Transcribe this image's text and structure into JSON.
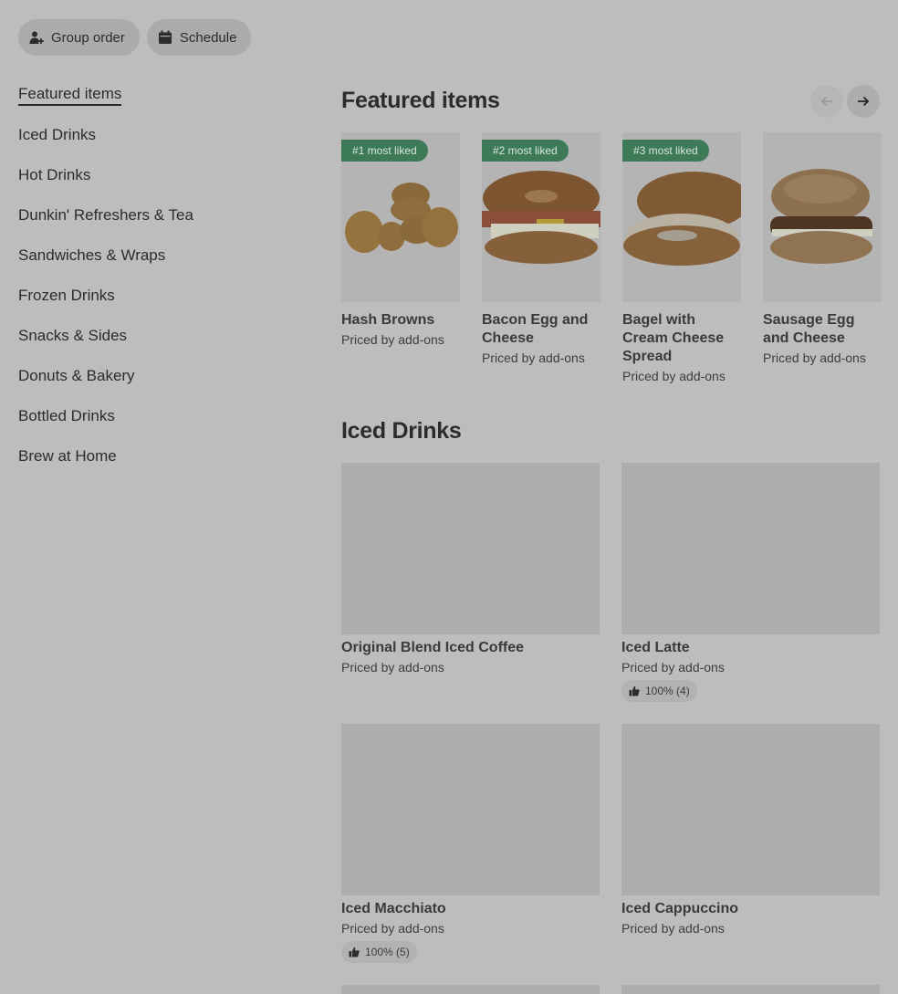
{
  "top_buttons": {
    "group_order": "Group order",
    "schedule": "Schedule"
  },
  "sidebar": {
    "items": [
      {
        "label": "Featured items"
      },
      {
        "label": "Iced Drinks"
      },
      {
        "label": "Hot Drinks"
      },
      {
        "label": "Dunkin' Refreshers & Tea"
      },
      {
        "label": "Sandwiches & Wraps"
      },
      {
        "label": "Frozen Drinks"
      },
      {
        "label": "Snacks & Sides"
      },
      {
        "label": "Donuts & Bakery"
      },
      {
        "label": "Bottled Drinks"
      },
      {
        "label": "Brew at Home"
      }
    ]
  },
  "featured": {
    "title": "Featured items",
    "items": [
      {
        "badge": "#1 most liked",
        "name": "Hash Browns",
        "price": "Priced by add-ons"
      },
      {
        "badge": "#2 most liked",
        "name": "Bacon Egg and Cheese",
        "price": "Priced by add-ons"
      },
      {
        "badge": "#3 most liked",
        "name": "Bagel with Cream Cheese Spread",
        "price": "Priced by add-ons"
      },
      {
        "badge": "",
        "name": "Sausage Egg and Cheese",
        "price": "Priced by add-ons"
      }
    ]
  },
  "iced": {
    "title": "Iced Drinks",
    "items": [
      {
        "name": "Original Blend Iced Coffee",
        "price": "Priced by add-ons",
        "rating": ""
      },
      {
        "name": "Iced Latte",
        "price": "Priced by add-ons",
        "rating": "100% (4)"
      },
      {
        "name": "Iced Macchiato",
        "price": "Priced by add-ons",
        "rating": "100% (5)"
      },
      {
        "name": "Iced Cappuccino",
        "price": "Priced by add-ons",
        "rating": ""
      }
    ]
  },
  "colors": {
    "background": "#bdbdbd",
    "badge": "#3d7a57"
  }
}
